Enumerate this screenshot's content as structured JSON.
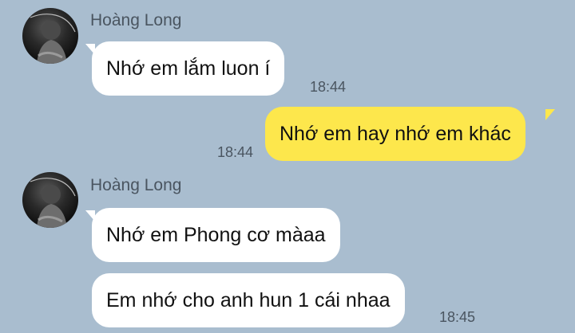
{
  "colors": {
    "background": "#a9bdcf",
    "incoming_bubble": "#ffffff",
    "outgoing_bubble": "#fde74c",
    "meta_text": "#4a5560"
  },
  "messages": [
    {
      "sender": "Hoàng Long",
      "text": "Nhớ em lắm luon í",
      "time": "18:44",
      "direction": "incoming"
    },
    {
      "text": "Nhớ em hay nhớ em khác",
      "time": "18:44",
      "direction": "outgoing"
    },
    {
      "sender": "Hoàng Long",
      "text": "Nhớ em Phong cơ màaa",
      "direction": "incoming"
    },
    {
      "text": "Em nhớ cho anh hun 1 cái nhaa",
      "time": "18:45",
      "direction": "incoming"
    }
  ]
}
